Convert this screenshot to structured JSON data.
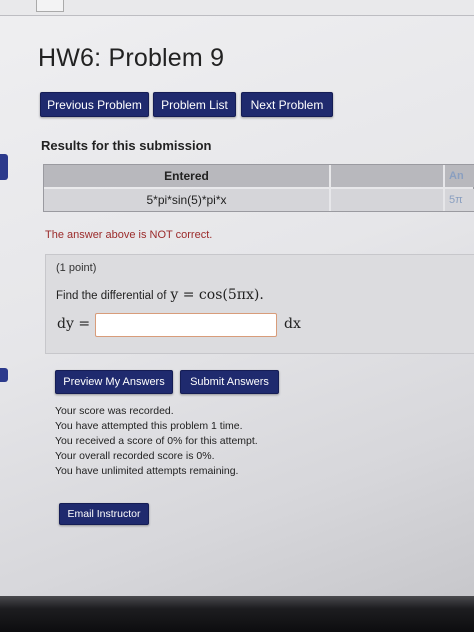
{
  "page": {
    "title": "HW6: Problem 9"
  },
  "nav": {
    "previous_label": "Previous Problem",
    "list_label": "Problem List",
    "next_label": "Next Problem"
  },
  "results": {
    "heading": "Results for this submission",
    "columns": [
      "Entered",
      "",
      "An"
    ],
    "row": [
      "5*pi*sin(5)*pi*x",
      "",
      "5π"
    ],
    "status_text": "The answer above is NOT correct.",
    "status_color": "#9b2a2a"
  },
  "problem": {
    "points": "(1 point)",
    "prompt": "Find the differential of",
    "equation": "y = cos(5πx).",
    "dy_label": "dy =",
    "answer_value": "",
    "dx_label": "dx"
  },
  "actions": {
    "preview_label": "Preview My Answers",
    "submit_label": "Submit Answers"
  },
  "score": {
    "lines": [
      "Your score was recorded.",
      "You have attempted this problem 1 time.",
      "You received a score of 0% for this attempt.",
      "Your overall recorded score is 0%.",
      "You have unlimited attempts remaining."
    ]
  },
  "footer": {
    "email_label": "Email Instructor"
  },
  "colors": {
    "button": "#1f2a6e",
    "button_text": "#ffffff",
    "error": "#9b2a2a"
  }
}
